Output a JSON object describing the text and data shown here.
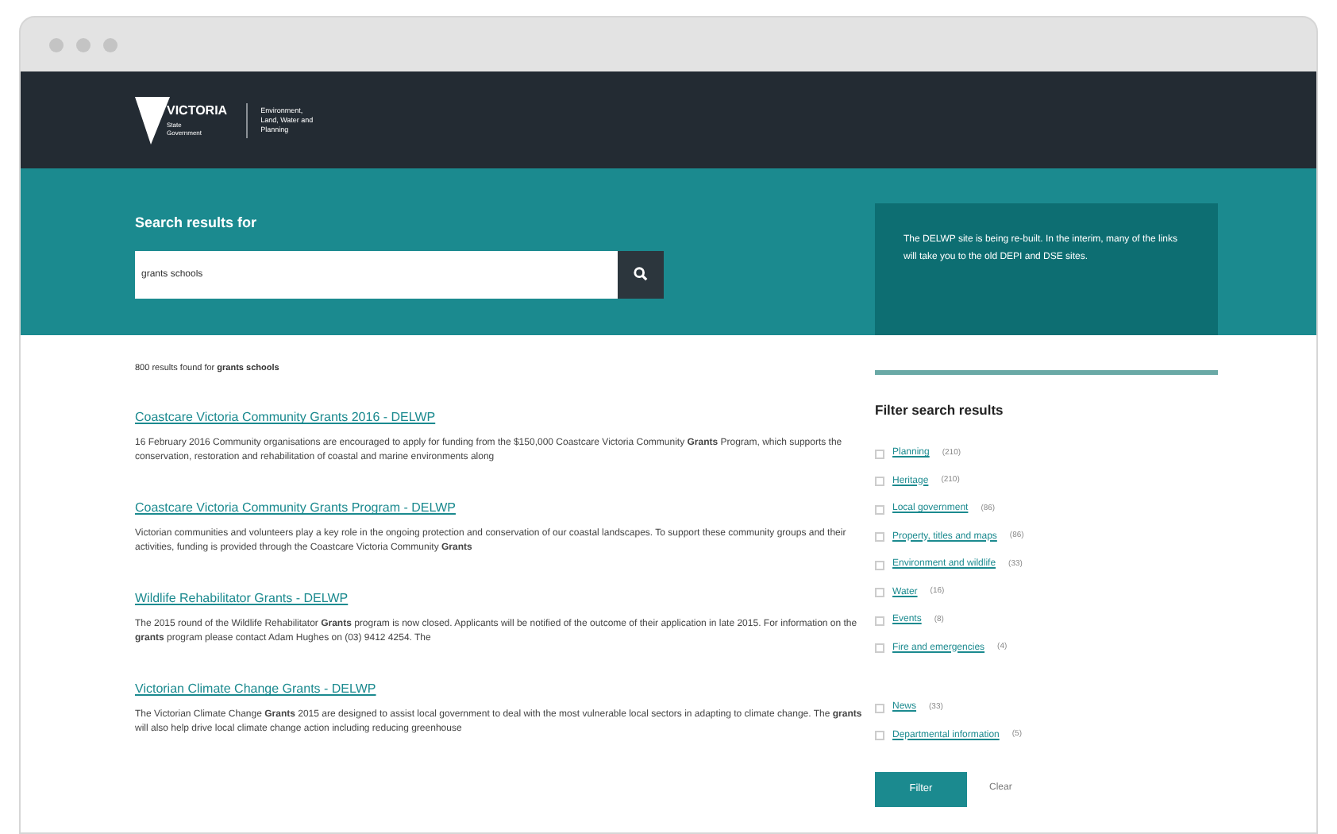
{
  "logo": {
    "wordmark": "VICTORIA",
    "subtitle": "State Government",
    "department": "Environment, Land, Water and Planning"
  },
  "search": {
    "label": "Search results for",
    "value": "grants schools"
  },
  "notice": "The DELWP site is being re-built. In the interim, many of the links will take you to the old DEPI and DSE sites.",
  "summary": "800 results found for **grants schools**",
  "results": [
    {
      "title": "Coastcare Victoria Community Grants 2016 - DELWP",
      "snippet": "16 February 2016 Community organisations are encouraged to apply for funding from the $150,000 Coastcare Victoria Community **Grants** Program, which supports the conservation, restoration and rehabilitation of coastal and marine environments along"
    },
    {
      "title": "Coastcare Victoria Community Grants Program - DELWP",
      "snippet": "Victorian communities and volunteers play a key role in the ongoing protection and conservation of our coastal landscapes. To support these community groups and their activities, funding is provided through the Coastcare Victoria Community **Grants**"
    },
    {
      "title": "Wildlife Rehabilitator Grants - DELWP",
      "snippet": "The 2015 round of the Wildlife Rehabilitator **Grants** program is now closed. Applicants will be notified of the outcome of their application in late 2015. For information on the **grants** program please contact Adam Hughes on (03) 9412 4254. The"
    },
    {
      "title": "Victorian Climate Change Grants - DELWP",
      "snippet": "The Victorian Climate Change **Grants** 2015 are designed to assist local government to deal with the most vulnerable local sectors in adapting to climate change. The **grants** will also help drive local climate change action including reducing greenhouse"
    }
  ],
  "filter": {
    "title": "Filter search results",
    "groups": [
      [
        {
          "label": "Planning",
          "count": "(210)",
          "checked": false
        },
        {
          "label": "Heritage",
          "count": "(210)",
          "checked": false
        },
        {
          "label": "Local government",
          "count": "(86)",
          "checked": false
        },
        {
          "label": "Property, titles and maps",
          "count": "(86)",
          "checked": false
        },
        {
          "label": "Environment and wildlife",
          "count": "(33)",
          "checked": false
        },
        {
          "label": "Water",
          "count": "(16)",
          "checked": false
        },
        {
          "label": "Events",
          "count": "(8)",
          "checked": false
        },
        {
          "label": "Fire and emergencies",
          "count": "(4)",
          "checked": false
        }
      ],
      [
        {
          "label": "News",
          "count": "(33)",
          "checked": false
        },
        {
          "label": "Departmental information",
          "count": "(5)",
          "checked": false
        }
      ]
    ],
    "apply": "Filter",
    "clear": "Clear"
  }
}
